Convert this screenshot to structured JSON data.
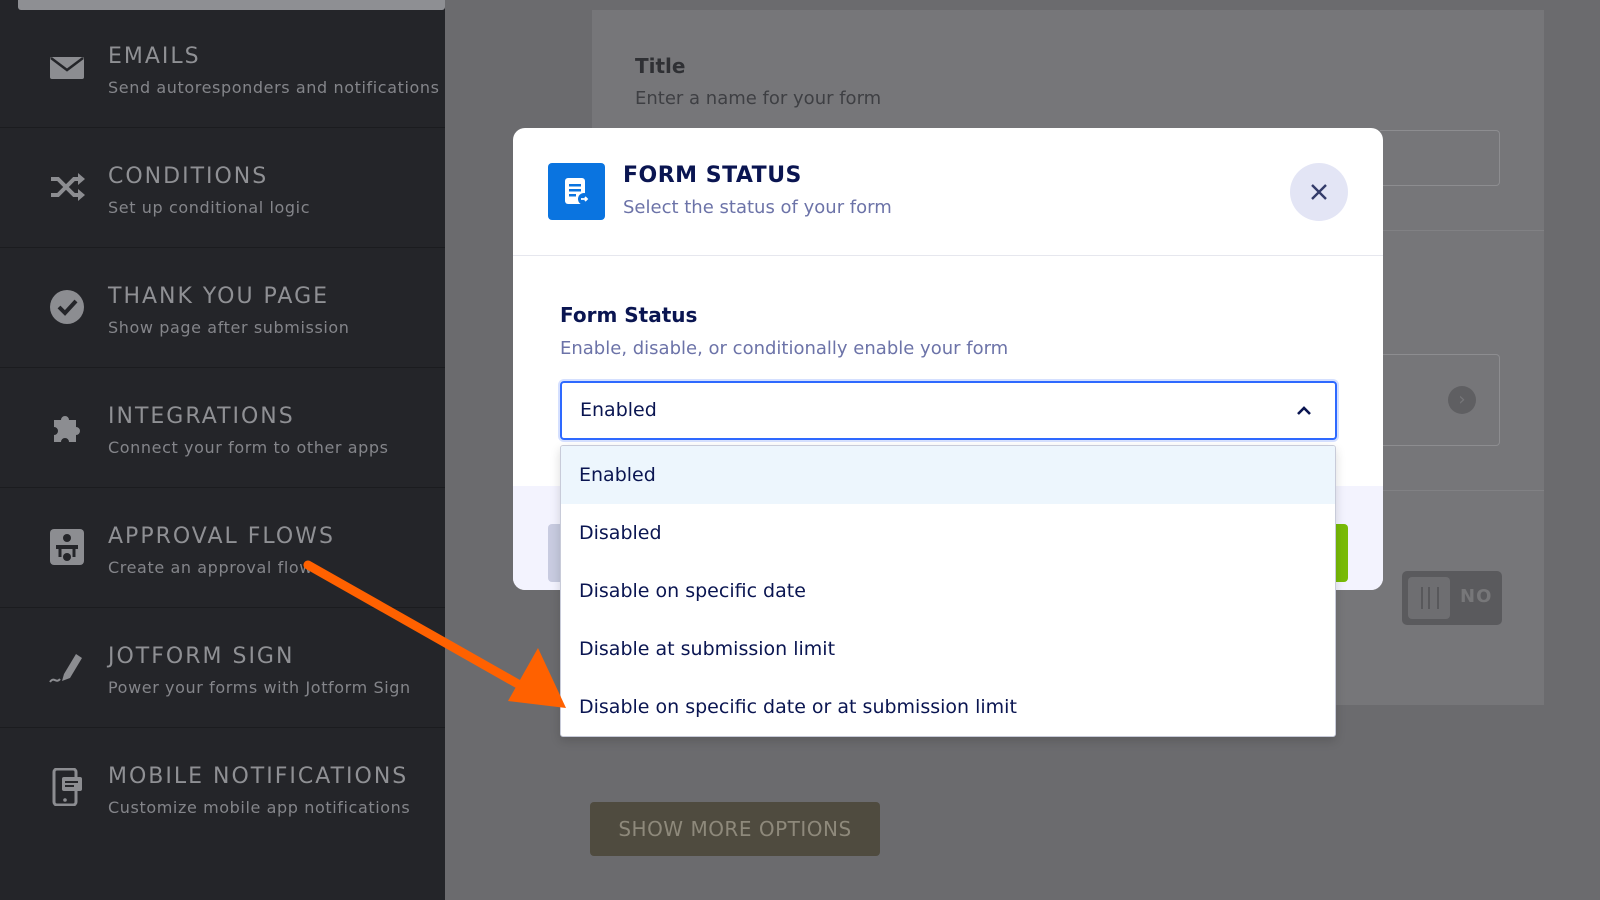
{
  "sidebar": {
    "items": [
      {
        "icon": "envelope-icon",
        "title": "EMAILS",
        "subtitle": "Send autoresponders and notifications"
      },
      {
        "icon": "shuffle-icon",
        "title": "CONDITIONS",
        "subtitle": "Set up conditional logic"
      },
      {
        "icon": "check-circle-icon",
        "title": "THANK YOU PAGE",
        "subtitle": "Show page after submission"
      },
      {
        "icon": "puzzle-icon",
        "title": "INTEGRATIONS",
        "subtitle": "Connect your form to other apps"
      },
      {
        "icon": "approval-flow-icon",
        "title": "APPROVAL FLOWS",
        "subtitle": "Create an approval flow"
      },
      {
        "icon": "pen-sign-icon",
        "title": "JOTFORM SIGN",
        "subtitle": "Power your forms with Jotform Sign"
      },
      {
        "icon": "mobile-icon",
        "title": "MOBILE NOTIFICATIONS",
        "subtitle": "Customize mobile app notifications"
      }
    ]
  },
  "page": {
    "title": "Title",
    "subtitle": "Enter a name for your form",
    "toggle_label": "NO",
    "show_more": "SHOW MORE OPTIONS"
  },
  "modal": {
    "icon": "form-document-icon",
    "title": "FORM STATUS",
    "subtitle": "Select the status of your form",
    "close_icon": "close-icon",
    "field_label": "Form Status",
    "field_description": "Enable, disable, or conditionally enable your form",
    "selected_value": "Enabled",
    "options": [
      "Enabled",
      "Disabled",
      "Disable on specific date",
      "Disable at submission limit",
      "Disable on specific date or at submission limit"
    ]
  },
  "colors": {
    "sidebar_bg": "#242529",
    "overlay_bg": "#6b6b6e",
    "brand_blue": "#0a74e0",
    "focus_blue": "#2e69ff",
    "submit_green": "#78bb07",
    "annotation_orange": "#ff6100",
    "selected_option_bg": "#edf6fd"
  }
}
